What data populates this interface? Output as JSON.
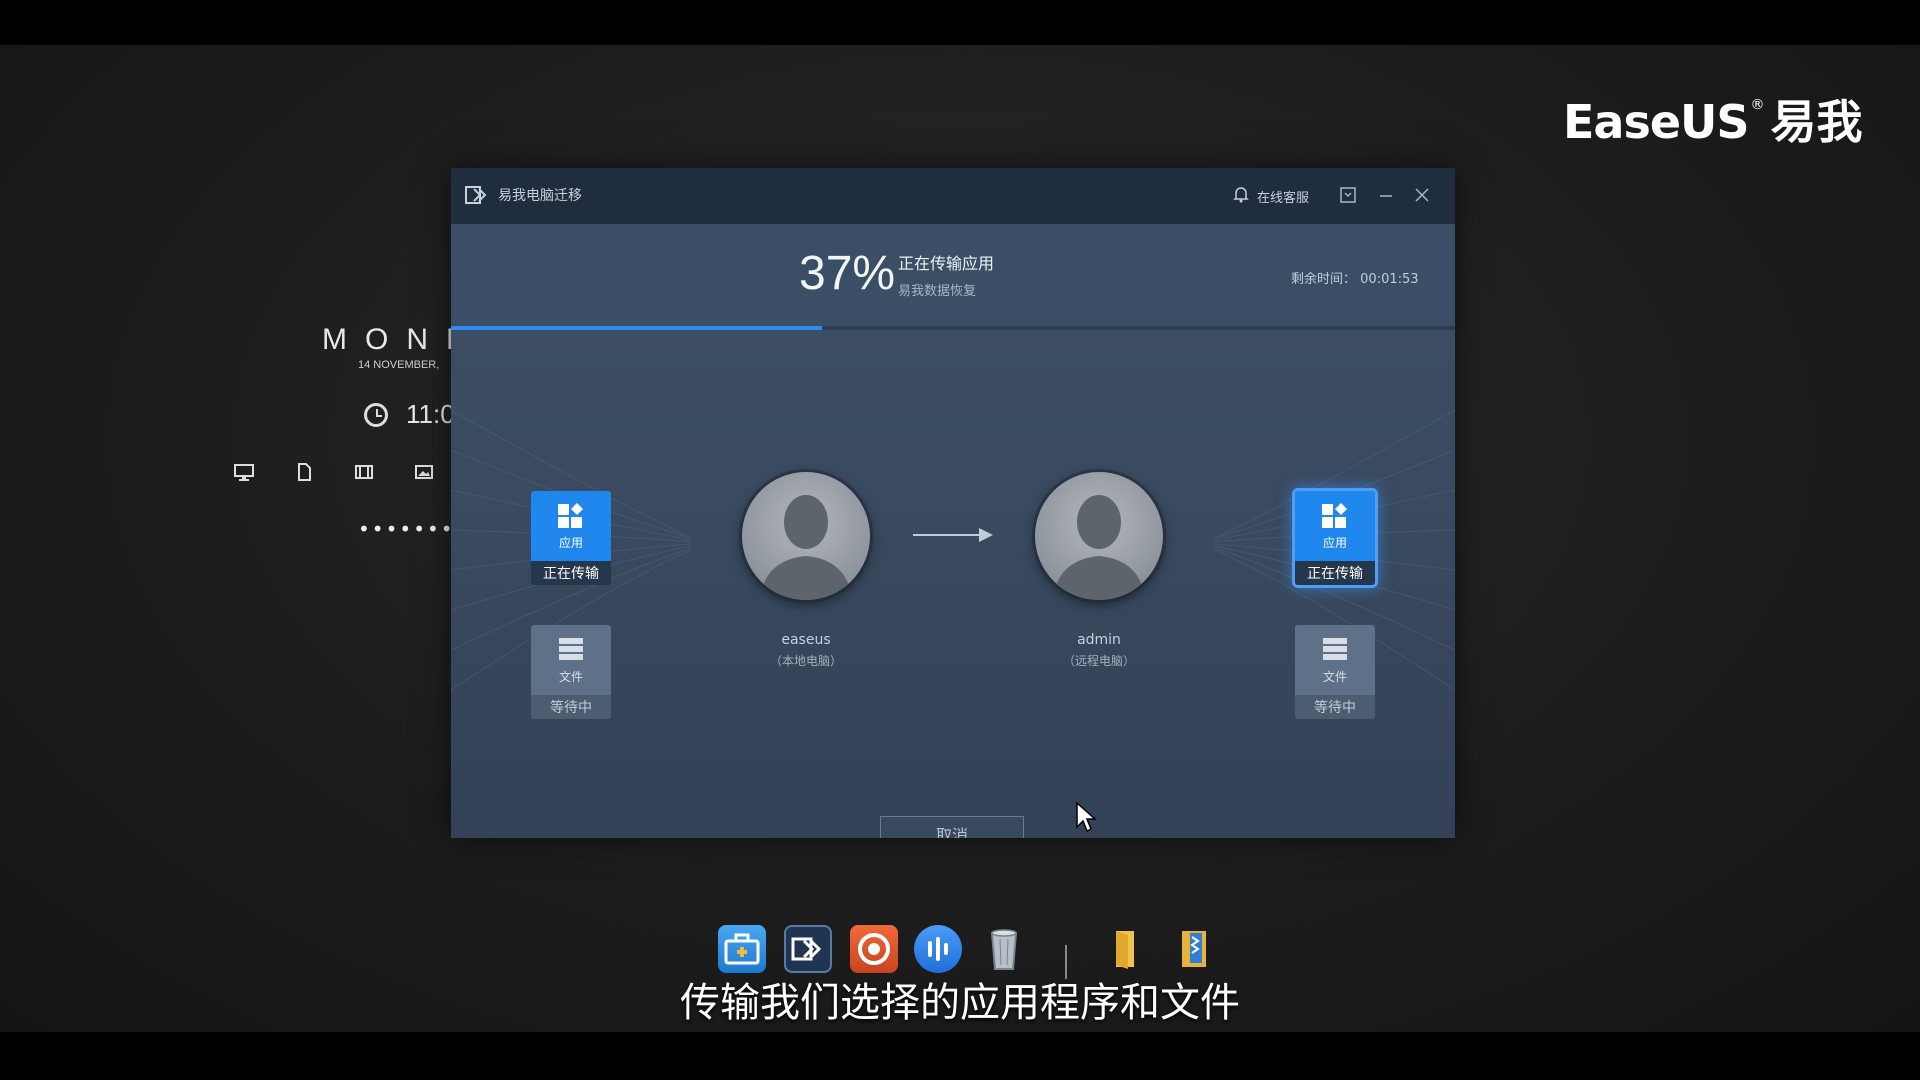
{
  "brand": {
    "name_en": "EaseUS",
    "registered": "®",
    "name_cn": "易我"
  },
  "clock_widget": {
    "day": "MONDAY",
    "date": "14 NOVEMBER,",
    "time": "11:0",
    "password_mask": "••••••••"
  },
  "window": {
    "title": "易我电脑迁移",
    "support_label": "在线客服",
    "progress": {
      "percent_text": "37%",
      "percent_value": 37,
      "status": "正在传输应用",
      "sub_status": "易我数据恢复",
      "remaining_label": "剩余时间：",
      "remaining_value": "00:01:53"
    },
    "source": {
      "name": "easeus",
      "role": "（本地电脑）",
      "tiles": [
        {
          "label": "应用",
          "status": "正在传输"
        },
        {
          "label": "文件",
          "status": "等待中"
        }
      ]
    },
    "target": {
      "name": "admin",
      "role": "（远程电脑）",
      "tiles": [
        {
          "label": "应用",
          "status": "正在传输"
        },
        {
          "label": "文件",
          "status": "等待中"
        }
      ]
    },
    "cancel_label": "取消"
  },
  "dock": {
    "items": [
      {
        "icon": "toolbox-icon",
        "color": "#2e8fe6"
      },
      {
        "icon": "todo-pctrans-icon",
        "color": "#1f3552"
      },
      {
        "icon": "record-icon",
        "color": "#e4572e"
      },
      {
        "icon": "voice-icon",
        "color": "#2f7fe8"
      },
      {
        "icon": "recycle-bin-icon",
        "color": "#9aa3ab"
      },
      {
        "icon": "folder-icon",
        "color": "#f2c14e"
      },
      {
        "icon": "archive-icon",
        "color": "#e8b33a"
      }
    ]
  },
  "subtitle": "传输我们选择的应用程序和文件",
  "colors": {
    "accent": "#2e8cf0",
    "window_bg": "#3a4e66",
    "titlebar": "#1f2d3f"
  }
}
